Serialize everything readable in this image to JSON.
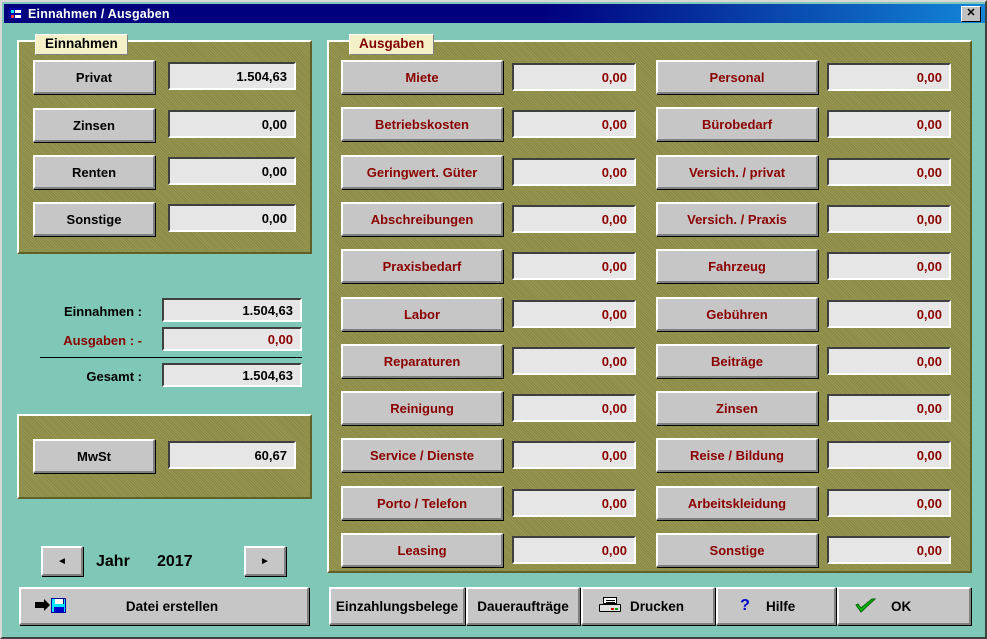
{
  "window": {
    "title": "Einnahmen / Ausgaben",
    "icon": "list-window-icon",
    "close_label": "✕",
    "colors": {
      "titlebar": "#00007e",
      "background": "#7fc8b8",
      "group_panel": "#8f8f45",
      "caption_bg": "#f4f0c8",
      "button_face": "#c6c6c6",
      "field_bg": "#e6e6e6",
      "expense_text": "#8b0000"
    }
  },
  "income": {
    "caption": "Einnahmen",
    "rows": [
      {
        "label": "Privat",
        "value": "1.504,63"
      },
      {
        "label": "Zinsen",
        "value": "0,00"
      },
      {
        "label": "Renten",
        "value": "0,00"
      },
      {
        "label": "Sonstige",
        "value": "0,00"
      }
    ]
  },
  "summary": {
    "income_label": "Einnahmen :",
    "income_value": "1.504,63",
    "expense_label": "Ausgaben : -",
    "expense_value": "0,00",
    "total_label": "Gesamt :",
    "total_value": "1.504,63"
  },
  "vat": {
    "label": "MwSt",
    "value": "60,67"
  },
  "year": {
    "prev_label": "◄",
    "next_label": "►",
    "label": "Jahr",
    "value": "2017"
  },
  "file_button": {
    "label": "Datei erstellen",
    "icon": "save-to-file-icon"
  },
  "expenses": {
    "caption": "Ausgaben",
    "left_rows": [
      {
        "label": "Miete",
        "value": "0,00"
      },
      {
        "label": "Betriebskosten",
        "value": "0,00"
      },
      {
        "label": "Geringwert. Güter",
        "value": "0,00"
      },
      {
        "label": "Abschreibungen",
        "value": "0,00"
      },
      {
        "label": "Praxisbedarf",
        "value": "0,00"
      },
      {
        "label": "Labor",
        "value": "0,00"
      },
      {
        "label": "Reparaturen",
        "value": "0,00"
      },
      {
        "label": "Reinigung",
        "value": "0,00"
      },
      {
        "label": "Service / Dienste",
        "value": "0,00"
      },
      {
        "label": "Porto / Telefon",
        "value": "0,00"
      },
      {
        "label": "Leasing",
        "value": "0,00"
      }
    ],
    "right_rows": [
      {
        "label": "Personal",
        "value": "0,00"
      },
      {
        "label": "Bürobedarf",
        "value": "0,00"
      },
      {
        "label": "Versich. / privat",
        "value": "0,00"
      },
      {
        "label": "Versich. / Praxis",
        "value": "0,00"
      },
      {
        "label": "Fahrzeug",
        "value": "0,00"
      },
      {
        "label": "Gebühren",
        "value": "0,00"
      },
      {
        "label": "Beiträge",
        "value": "0,00"
      },
      {
        "label": "Zinsen",
        "value": "0,00"
      },
      {
        "label": "Reise / Bildung",
        "value": "0,00"
      },
      {
        "label": "Arbeitskleidung",
        "value": "0,00"
      },
      {
        "label": "Sonstige",
        "value": "0,00"
      }
    ]
  },
  "toolbar": {
    "deposit_slips": "Einzahlungsbelege",
    "standing_orders": "Daueraufträge",
    "print": "Drucken",
    "help": "Hilfe",
    "help_icon_glyph": "?",
    "ok": "OK"
  }
}
